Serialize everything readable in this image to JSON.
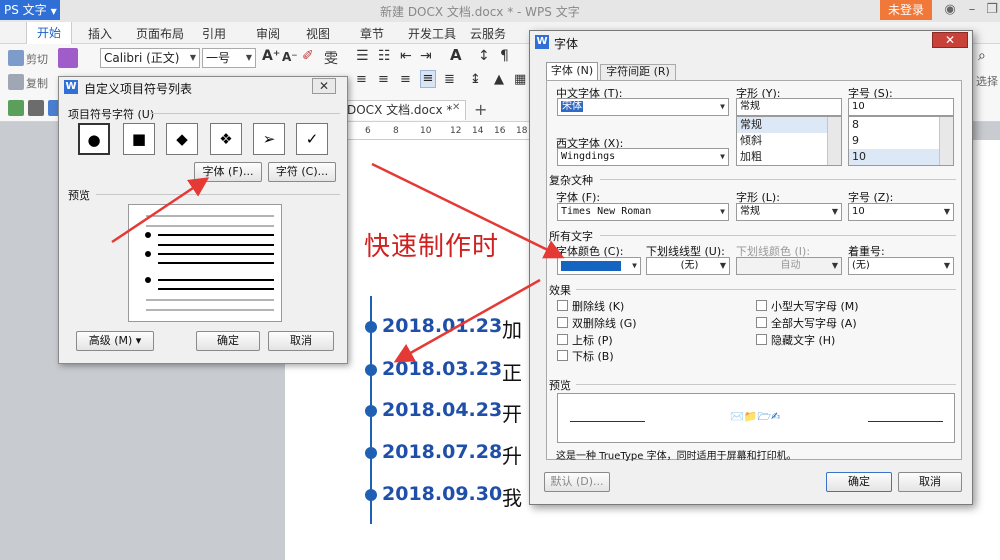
{
  "titlebar": {
    "app_name": "PS 文字",
    "doc_title": "新建 DOCX 文档.docx * - WPS 文字",
    "login_label": "未登录"
  },
  "menu": {
    "items": [
      "开始",
      "插入",
      "页面布局",
      "引用",
      "审阅",
      "视图",
      "章节",
      "开发工具",
      "云服务"
    ]
  },
  "ribbon": {
    "cut_label": "剪切",
    "copy_label": "复制",
    "font_name": "Calibri (正文)",
    "font_size": "一号",
    "select_label": "选择"
  },
  "doc_tab": {
    "label": "DOCX 文档.docx *",
    "ruler_numbers": [
      "6",
      "8",
      "10",
      "12",
      "14",
      "16",
      "18"
    ]
  },
  "document": {
    "heading": "快速制作时",
    "timeline": [
      {
        "date": "2018.01.23",
        "char": "加"
      },
      {
        "date": "2018.03.23",
        "char": "正"
      },
      {
        "date": "2018.04.23",
        "char": "开"
      },
      {
        "date": "2018.07.28",
        "char": "升"
      },
      {
        "date": "2018.09.30",
        "char": "我"
      }
    ]
  },
  "bullet_dialog": {
    "title": "自定义项目符号列表",
    "section_label": "项目符号字符 (U)",
    "symbols": [
      "●",
      "■",
      "◆",
      "❖",
      "➢",
      "✓"
    ],
    "font_button": "字体 (F)...",
    "char_button": "字符 (C)...",
    "preview_label": "预览",
    "advanced_button": "高级 (M) ▾",
    "ok_button": "确定",
    "cancel_button": "取消"
  },
  "font_dialog": {
    "title": "字体",
    "tabs": [
      "字体 (N)",
      "字符间距 (R)"
    ],
    "cn_font_label": "中文字体 (T):",
    "cn_font_value": "宋体",
    "style_label": "字形 (Y):",
    "style_value": "常规",
    "style_options": [
      "常规",
      "倾斜",
      "加粗"
    ],
    "size_label": "字号 (S):",
    "size_value": "10",
    "size_options": [
      "8",
      "9",
      "10"
    ],
    "west_font_label": "西文字体 (X):",
    "west_font_value": "Wingdings",
    "complex_title": "复杂文种",
    "complex_font_label": "字体 (F):",
    "complex_font_value": "Times New Roman",
    "complex_style_label": "字形 (L):",
    "complex_style_value": "常规",
    "complex_size_label": "字号 (Z):",
    "complex_size_value": "10",
    "all_text_title": "所有文字",
    "color_label": "字体颜色 (C):",
    "underline_label": "下划线线型 (U):",
    "underline_value": "(无)",
    "underline_color_label": "下划线颜色 (I):",
    "underline_color_value": "自动",
    "emphasis_label": "着重号:",
    "emphasis_value": "(无)",
    "effects_title": "效果",
    "effects_left": [
      "删除线 (K)",
      "双删除线 (G)",
      "上标 (P)",
      "下标 (B)"
    ],
    "effects_right": [
      "小型大写字母 (M)",
      "全部大写字母 (A)",
      "隐藏文字 (H)"
    ],
    "preview_title": "预览",
    "preview_sample": "✉️📁🗁✍",
    "truetype_note": "这是一种 TrueType 字体，同时适用于屏幕和打印机。",
    "default_button": "默认 (D)...",
    "ok_button": "确定",
    "cancel_button": "取消"
  },
  "colors": {
    "accent_blue": "#1f5fb4",
    "heading_red": "#d02020",
    "font_color_swatch": "#1565c0",
    "arrow_red": "#e53935",
    "login_orange": "#f07838"
  }
}
